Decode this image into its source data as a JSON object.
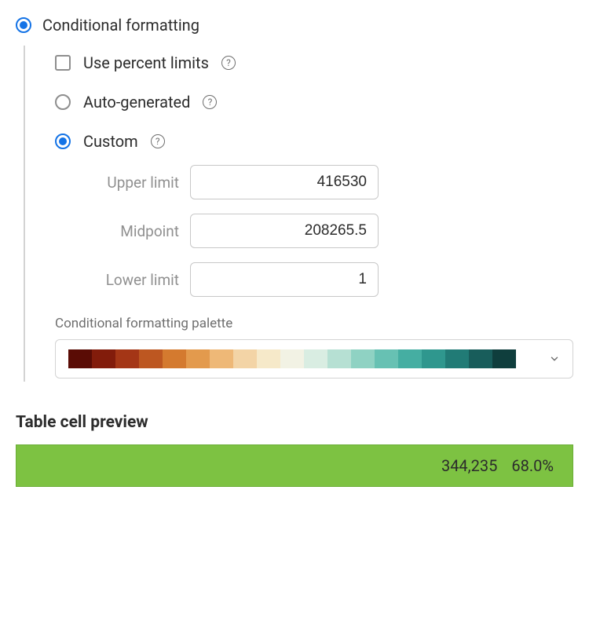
{
  "section": {
    "title": "Conditional formatting"
  },
  "options": {
    "use_percent_limits": "Use percent limits",
    "auto_generated": "Auto-generated",
    "custom": "Custom"
  },
  "limits": {
    "upper_label": "Upper limit",
    "upper_value": "416530",
    "mid_label": "Midpoint",
    "mid_value": "208265.5",
    "lower_label": "Lower limit",
    "lower_value": "1"
  },
  "palette": {
    "label": "Conditional formatting palette",
    "colors": [
      "#5a0c05",
      "#821c0b",
      "#a43616",
      "#bd5721",
      "#d47a2f",
      "#e39a4d",
      "#eeb877",
      "#f3d4a6",
      "#f6e9c9",
      "#f2f2e4",
      "#d9ede2",
      "#b6e0d3",
      "#8fd2c3",
      "#67c1b3",
      "#45aea2",
      "#2f978e",
      "#217b76",
      "#185d5b",
      "#0f3e3d"
    ]
  },
  "preview": {
    "title": "Table cell preview",
    "value": "344,235",
    "percent": "68.0%",
    "bg_color": "#7dc242"
  }
}
